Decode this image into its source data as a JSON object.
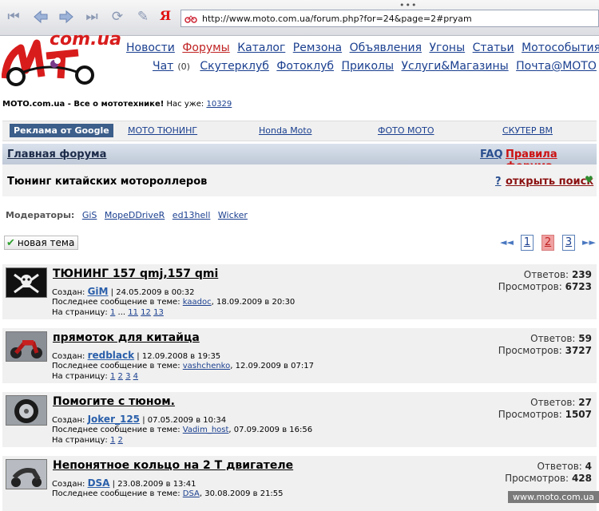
{
  "browser": {
    "url": "http://www.moto.com.ua/forum.php?for=24&page=2#pryam",
    "menu_dots": "•••",
    "yandex": "Я"
  },
  "logo": {
    "text": "com.ua"
  },
  "nav": {
    "row1": [
      "Новости",
      "Форумы",
      "Каталог",
      "Ремзона",
      "Объявления",
      "Угоны",
      "Статьи",
      "Мотособытия"
    ],
    "row2_chat": "Чат",
    "row2_chat_count": "(0)",
    "row2": [
      "Скутерклуб",
      "Фотоклуб",
      "Приколы",
      "Услуги&Магазины",
      "Почта@МОТО"
    ]
  },
  "tagline": {
    "site": "MOTO.com.ua - Все о мототехнике!",
    "members_label": "Нас уже:",
    "members_count": "10329"
  },
  "ads": {
    "badge": "Реклама от Google",
    "links": [
      "МОТО ТЮНИНГ",
      "Honda Moto",
      "ФОТО МОТО",
      "СКУТЕР ВМ"
    ]
  },
  "forum": {
    "home": "Главная форума",
    "faq": "FAQ",
    "rules": "Правила форума",
    "name": "Тюнинг китайских мотороллеров",
    "help": "?",
    "search": "открыть поиск",
    "heart": "♥"
  },
  "moderators": {
    "label": "Модераторы:",
    "names": [
      "GiS",
      "MopeDDriveR",
      "ed13hell",
      "Wicker"
    ]
  },
  "new_topic": {
    "icon": "✔",
    "label": "новая тема"
  },
  "pager": {
    "prev": "◄◄",
    "pages": [
      "1",
      "2",
      "3"
    ],
    "current": "2",
    "next": "►►"
  },
  "topics": [
    {
      "title": "ТЮНИНГ 157 qmj,157 qmi",
      "created_label": "Создан:",
      "author": "GiM",
      "created": "| 24.05.2009 в 00:32",
      "last_label": "Последнее сообщение в теме:",
      "last_user": "kaadoc",
      "last_date": ", 18.09.2009 в 20:30",
      "pages_label": "На страницу:",
      "pages": [
        "1",
        "...",
        "11",
        "12",
        "13"
      ],
      "replies_label": "Ответов:",
      "replies": "239",
      "views_label": "Просмотров:",
      "views": "6723",
      "thumb": "pirate-flag"
    },
    {
      "title": "прямоток для китайца",
      "created_label": "Создан:",
      "author": "redblack",
      "created": "| 12.09.2008 в 19:35",
      "last_label": "Последнее сообщение в теме:",
      "last_user": "vashchenko",
      "last_date": ", 12.09.2009 в 07:17",
      "pages_label": "На страницу:",
      "pages": [
        "1",
        "2",
        "3",
        "4"
      ],
      "replies_label": "Ответов:",
      "replies": "59",
      "views_label": "Просмотров:",
      "views": "3727",
      "thumb": "red-motorcycle"
    },
    {
      "title": "Помогите с тюном.",
      "created_label": "Создан:",
      "author": "Joker_125",
      "created": "| 07.05.2009 в 10:34",
      "last_label": "Последнее сообщение в теме:",
      "last_user": "Vadim_host",
      "last_date": ", 07.09.2009 в 16:56",
      "pages_label": "На страницу:",
      "pages": [
        "1",
        "2"
      ],
      "replies_label": "Ответов:",
      "replies": "27",
      "views_label": "Просмотров:",
      "views": "1507",
      "thumb": "wheel"
    },
    {
      "title": "Непонятное кольцо на 2 Т двигателе",
      "created_label": "Создан:",
      "author": "DSA",
      "created": "| 23.08.2009 в 13:41",
      "last_label": "Последнее сообщение в теме:",
      "last_user": "DSA",
      "last_date": ", 30.08.2009 в 21:55",
      "pages_label": "",
      "pages": [],
      "replies_label": "Ответов:",
      "replies": "4",
      "views_label": "Просмотров:",
      "views": "428",
      "thumb": "scooter"
    }
  ],
  "watermark": "www.moto.com.ua"
}
